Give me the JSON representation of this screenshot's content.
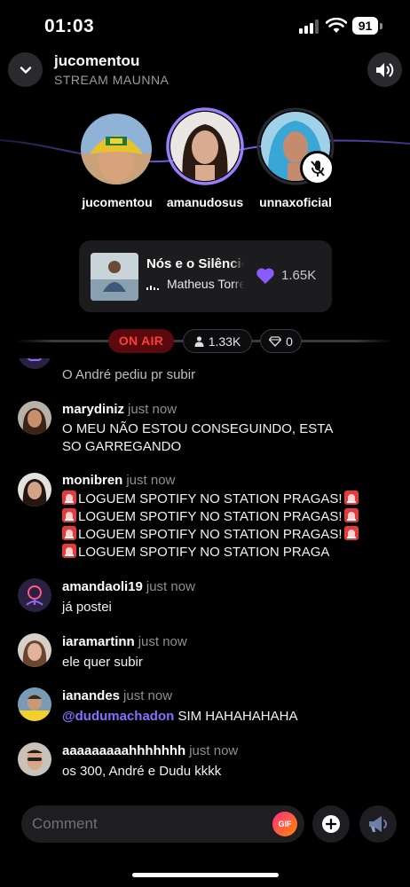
{
  "status_bar": {
    "time": "01:03",
    "battery": "91"
  },
  "header": {
    "title": "jucomentou",
    "subtitle": "STREAM MAUNNA"
  },
  "speakers": [
    {
      "name": "jucomentou"
    },
    {
      "name": "amanudosus",
      "speaking": true
    },
    {
      "name": "unnaxoficial",
      "muted": true
    }
  ],
  "now_playing": {
    "title": "Nós e o Silêncio",
    "artist": "Matheus Torres",
    "likes": "1.65K"
  },
  "badges": {
    "on_air": "ON AIR",
    "listeners": "1.33K",
    "gems": "0"
  },
  "chat": {
    "partial_message": "O André pediu pr subir",
    "messages": [
      {
        "user": "marydiniz",
        "when": "just now",
        "lines": [
          "O MEU NÃO ESTOU CONSEGUINDO, ESTA",
          "SO GARREGANDO"
        ]
      },
      {
        "user": "monibren",
        "when": "just now",
        "lines": [
          "LOGUEM SPOTIFY NO STATION PRAGAS!",
          "LOGUEM SPOTIFY NO STATION PRAGAS!",
          "LOGUEM SPOTIFY NO STATION PRAGAS!",
          "LOGUEM SPOTIFY NO STATION PRAGA"
        ]
      },
      {
        "user": "amandaoli19",
        "when": "just now",
        "lines": [
          "já postei"
        ]
      },
      {
        "user": "iaramartinn",
        "when": "just now",
        "lines": [
          "ele quer subir"
        ]
      },
      {
        "user": "ianandes",
        "when": "just now",
        "mention": "@dudumachadon",
        "text": " SIM HAHAHAHAHA"
      },
      {
        "user": "aaaaaaaaahhhhhhh",
        "when": "just now",
        "lines": [
          "os 300, André e Dudu kkkk"
        ]
      }
    ]
  },
  "composer": {
    "placeholder": "Comment",
    "gif_label": "GIF"
  },
  "colors": {
    "accent": "#7b5cff",
    "on_air_bg": "#5a0a0d",
    "on_air_text": "#ff3c3c",
    "heart": "#8a5cff"
  },
  "icons": [
    "chevron-down-icon",
    "speaker-volume-icon",
    "mic-off-icon",
    "heart-icon",
    "equalizer-icon",
    "person-icon",
    "diamond-icon",
    "siren-icon",
    "plus-icon",
    "megaphone-icon"
  ]
}
